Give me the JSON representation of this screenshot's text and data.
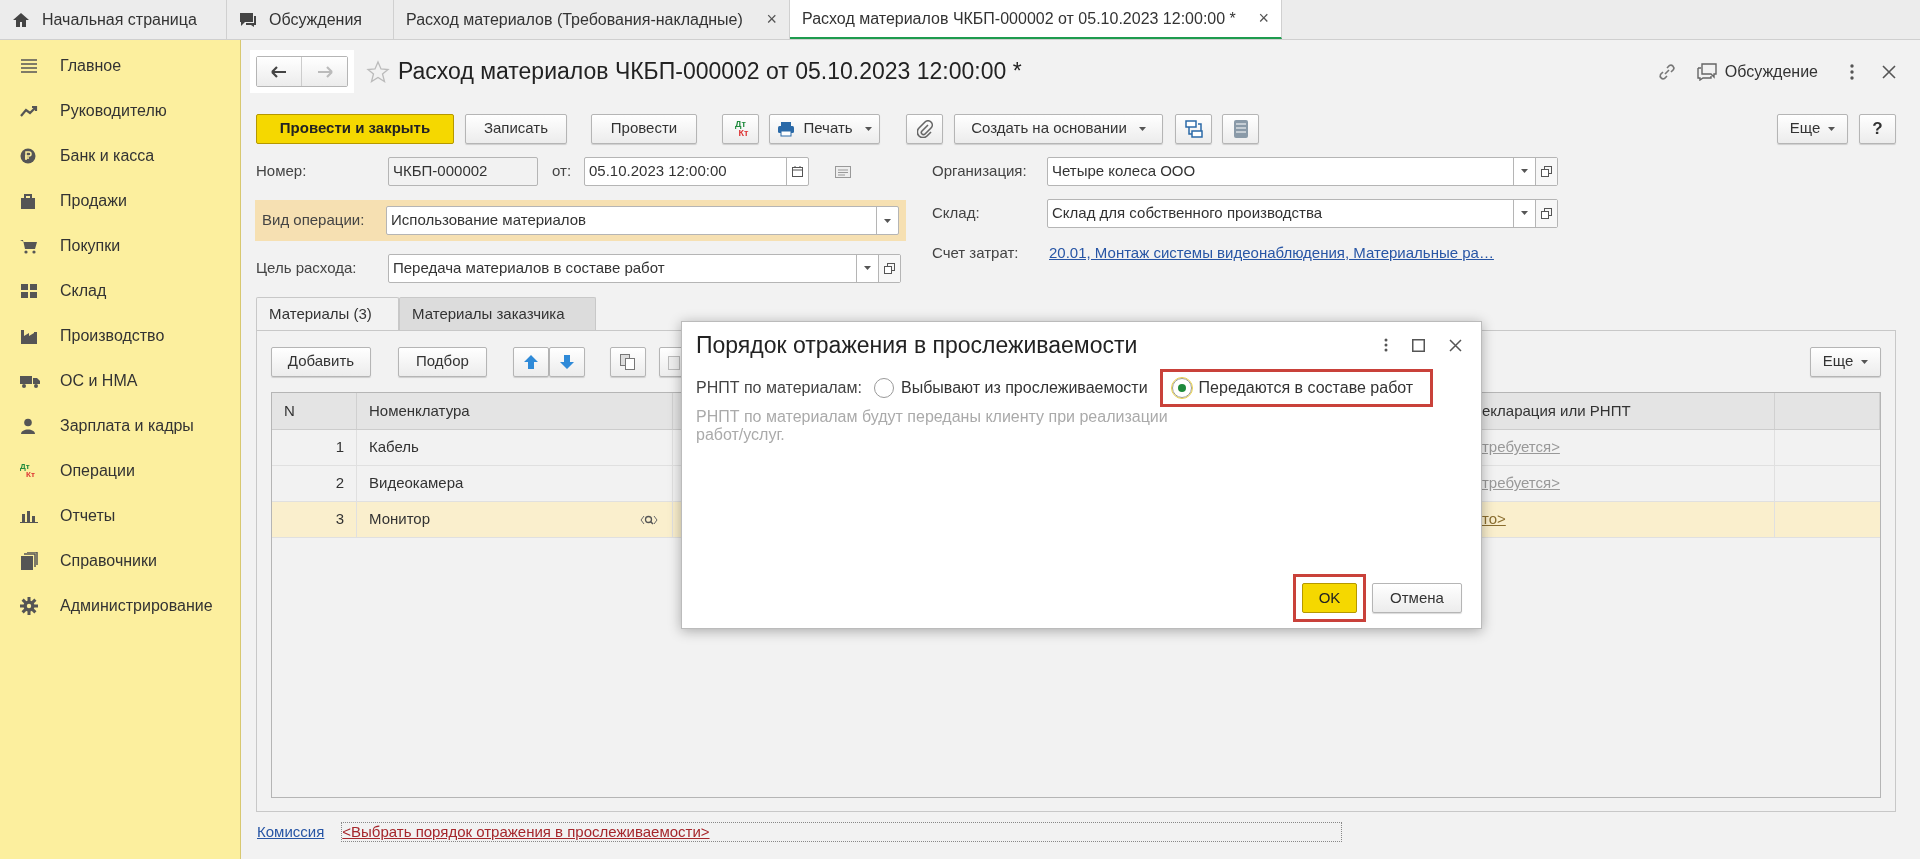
{
  "tabs": [
    {
      "label": "Начальная страница",
      "selected": false
    },
    {
      "label": "Обсуждения",
      "selected": false
    },
    {
      "label": "Расход материалов (Требования-накладные)",
      "close": "×",
      "selected": false
    },
    {
      "label": "Расход материалов ЧКБП-000002 от 05.10.2023 12:00:00 *",
      "close": "×",
      "selected": true
    }
  ],
  "sidebar": {
    "items": [
      {
        "label": "Главное"
      },
      {
        "label": "Руководителю"
      },
      {
        "label": "Банк и касса"
      },
      {
        "label": "Продажи"
      },
      {
        "label": "Покупки"
      },
      {
        "label": "Склад"
      },
      {
        "label": "Производство"
      },
      {
        "label": "ОС и НМА"
      },
      {
        "label": "Зарплата и кадры"
      },
      {
        "label": "Операции",
        "icon_text": [
          "Дт",
          "Кт"
        ]
      },
      {
        "label": "Отчеты"
      },
      {
        "label": "Справочники"
      },
      {
        "label": "Администрирование"
      }
    ]
  },
  "form": {
    "title": "Расход материалов ЧКБП-000002 от 05.10.2023 12:00:00 *",
    "discussion": "Обсуждение",
    "toolbar": [
      {
        "kind": "primary",
        "label": "Провести и закрыть"
      },
      {
        "kind": "text",
        "label": "Записать"
      },
      {
        "kind": "text",
        "label": "Провести"
      },
      {
        "kind": "dtkt",
        "icon_text": [
          "Дт",
          "Кт"
        ]
      },
      {
        "kind": "menu",
        "label": "Печать"
      },
      {
        "kind": "icon"
      },
      {
        "kind": "menu",
        "label": "Создать на основании"
      },
      {
        "kind": "icon"
      },
      {
        "kind": "icon"
      }
    ],
    "more": "Еще",
    "help": "?",
    "number": {
      "label": "Номер:",
      "value": "ЧКБП-000002"
    },
    "date": {
      "label": "от:",
      "value": "05.10.2023 12:00:00"
    },
    "left_fields": [
      {
        "label": "Вид операции:",
        "value": "Использование материалов",
        "highlighted": true,
        "kind": "select"
      },
      {
        "label": "Цель расхода:",
        "value": "Передача материалов в составе работ",
        "highlighted": false,
        "kind": "select_open"
      }
    ],
    "organization": {
      "label": "Организация:",
      "value": "Четыре колеса ООО"
    },
    "warehouse": {
      "label": "Склад:",
      "value": "Склад для собственного производства"
    },
    "account": {
      "label": "Счет затрат:",
      "value": "20.01, Монтаж системы видеонаблюдения, Материальные ра…"
    },
    "tabs": [
      {
        "label": "Материалы (3)",
        "selected": true
      },
      {
        "label": "Материалы заказчика",
        "selected": false
      }
    ],
    "table_toolbar": {
      "add": "Добавить",
      "pick": "Подбор",
      "more": "Еще"
    },
    "table": {
      "columns": [
        "N",
        "Номенклатура",
        "екларация или РНПТ"
      ],
      "rows": [
        {
          "n": "1",
          "name": "Кабель",
          "column_3": "требуется>",
          "selected": false
        },
        {
          "n": "2",
          "name": "Видеокамера",
          "column_3": "требуется>",
          "selected": false
        },
        {
          "n": "3",
          "name": "Монитор",
          "column_3": "то>",
          "selected": true
        }
      ]
    },
    "footer": {
      "commission": "Комиссия",
      "tracking_link": "<Выбрать порядок отражения в прослеживаемости>"
    }
  },
  "dialog": {
    "title": "Порядок отражения в прослеживаемости",
    "field_label": "РНПТ по материалам:",
    "options": [
      {
        "label": "Выбывают из прослеживаемости",
        "selected": false,
        "highlighted": false
      },
      {
        "label": "Передаются в составе работ",
        "selected": true,
        "highlighted": true
      }
    ],
    "hint": "РНПТ по материалам будут переданы клиенту при реализации работ/услуг.",
    "buttons": [
      {
        "label": "OK",
        "kind": "primary",
        "highlighted": true
      },
      {
        "label": "Отмена",
        "kind": "normal",
        "highlighted": false
      }
    ]
  }
}
